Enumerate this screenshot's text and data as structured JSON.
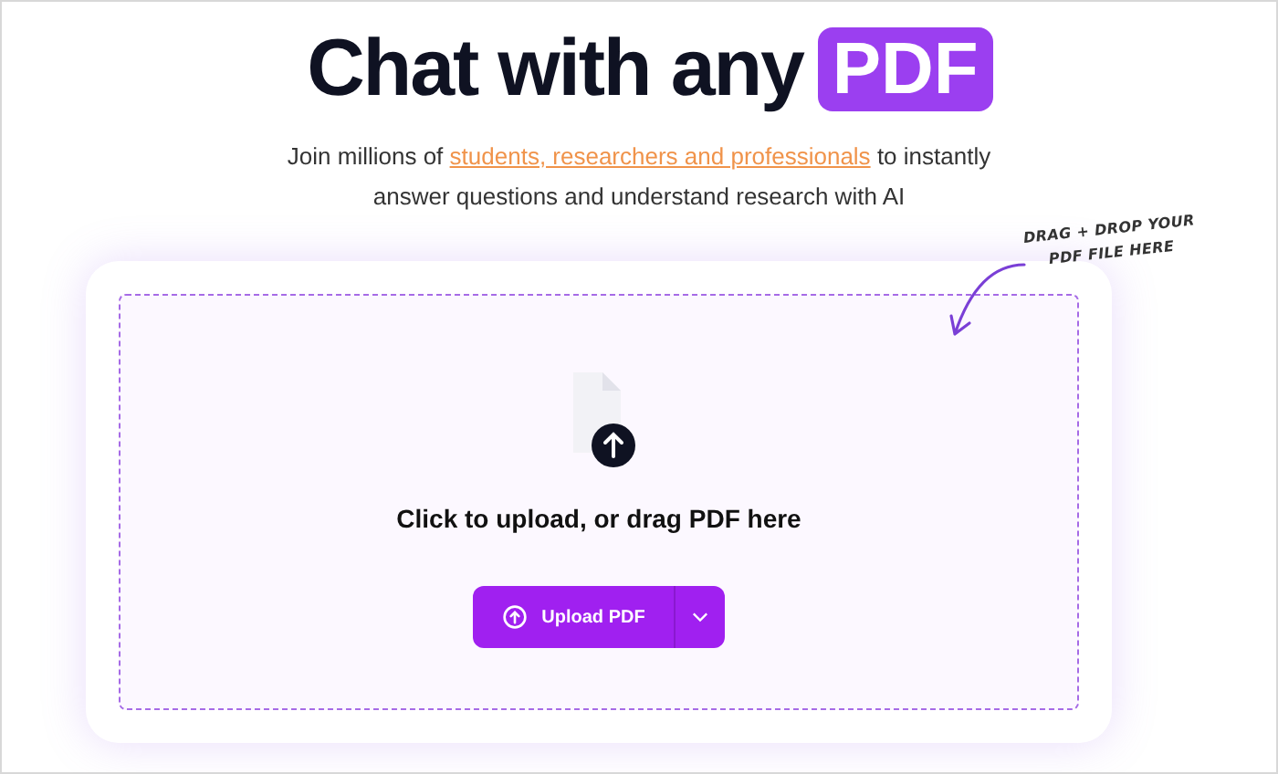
{
  "heading": {
    "text": "Chat with any",
    "badge": "PDF"
  },
  "subtitle": {
    "before": "Join millions of",
    "link": "students, researchers and professionals",
    "after": "to instantly answer questions and understand research with AI"
  },
  "annotation": {
    "lines": [
      "DRAG + DROP YOUR",
      "PDF FILE HERE"
    ]
  },
  "dropzone": {
    "prompt": "Click to upload, or drag PDF here",
    "button": "Upload PDF"
  }
}
